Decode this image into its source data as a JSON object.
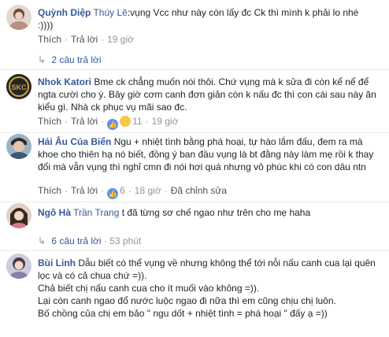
{
  "comments": [
    {
      "name": "Quỳnh Diệp",
      "tag": "Thúy Lê",
      "lines": [
        ":vụng Vcc như này còn lấy đc Ck thì mình k phải lo nhé",
        ":))))"
      ],
      "like_label": "Thích",
      "reply_label": "Trả lời",
      "time": "19 giờ",
      "replies_toggle": "2 câu trả lời",
      "avatar_color": "#d9c7c3"
    },
    {
      "name": "Nhok Katori",
      "tag": "",
      "text": "Bme ck chẳng muốn nói thôi. Chứ vụng mà k sửa đi còn kể nể để ngta cười cho ý. Bây giờ cơm canh đơn giản còn k nấu đc thì con cái sau này ăn kiểu gì. Nhà ck phục vụ mãi sao đc.",
      "like_label": "Thích",
      "reply_label": "Trả lời",
      "reaction_count": "11",
      "time": "19 giờ",
      "reactions": [
        "like",
        "wow"
      ],
      "avatar_color": "#2a2a2a",
      "avatar_text": "SKC"
    },
    {
      "name": "Hải Âu Của Biển",
      "tag": "",
      "text": "Ngu + nhiệt tình bằng phá hoại, tự hào lắm đấu, đem ra mà khoe cho thiên hạ nó biết, đồng ý ban đầu vụng là bt đằng này làm mẹ rồi k thay đổi mà vẫn vụng thì nghỉ cmn đi nói hơi quá nhưng vô phúc khi có con dâu ntn",
      "like_label": "Thích",
      "reply_label": "Trả lời",
      "reaction_count": "6",
      "time": "18 giờ",
      "edited_label": "Đã chỉnh sửa",
      "avatar_color": "#8aa6b8"
    },
    {
      "name": "Ngô Hà",
      "tag": "Trần Trang",
      "text": "t đã từng sơ chế ngao như trên cho mẹ haha",
      "replies_toggle": "6 câu trả lời",
      "replies_age": "53 phút",
      "avatar_color": "#c8a99a"
    },
    {
      "name": "Bùi Linh",
      "tag": "",
      "paragraphs": [
        "Dẫu biết có thể vụng về nhưng không thể tới nỗi nấu canh cua lại quên lọc và có cả chua chứ =)).",
        "Chả biết chị nấu canh cua cho ít muối vào không =)).",
        "Lại còn canh ngao đổ nước luộc ngao đi nữa thì em cũng chịu chị luôn.",
        "Bố chồng của chị em bảo \" ngu dốt + nhiệt tình = phá hoại \" đấy ạ =))"
      ],
      "avatar_color": "#b9b6c9"
    }
  ]
}
